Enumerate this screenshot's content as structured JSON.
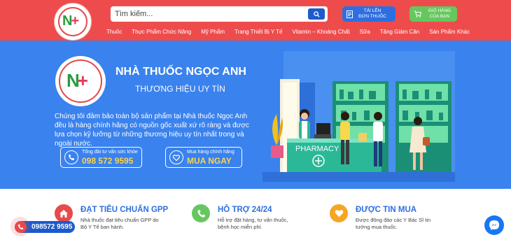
{
  "header": {
    "logo_alt": "Nhà Thuốc Ngọc Anh logo",
    "search": {
      "placeholder": "Tìm kiếm..."
    },
    "upload": {
      "line1": "TẢI LÊN",
      "line2": "ĐƠN THUỐC"
    },
    "cart": {
      "line1": "GIỎ HÀNG",
      "line2": "CỦA BẠN"
    },
    "nav": [
      {
        "label": "Thuốc"
      },
      {
        "label": "Thực Phẩm Chức Năng"
      },
      {
        "label": "Mỹ Phẩm"
      },
      {
        "label": "Trang Thiết Bị Y Tế"
      },
      {
        "label": "Vitamin – Khoáng Chất"
      },
      {
        "label": "Sữa"
      },
      {
        "label": "Tăng Giảm Cân"
      },
      {
        "label": "Sản Phẩm Khác"
      }
    ]
  },
  "hero": {
    "title": "NHÀ THUỐC NGỌC ANH",
    "subtitle": "THƯƠNG HIỆU UY TÍN",
    "description": "Chúng tôi đảm bảo toàn bộ sản phẩm tại Nhà thuốc Ngọc Anh đều là hàng chính hãng có nguồn gốc xuất xứ rõ ràng và được lựa chọn kỹ lưỡng từ những thương hiệu uy tín nhất trong và ngoài nước.",
    "hotline": {
      "label": "Tổng đài tư vấn sức khỏe",
      "value": "098 572 9595"
    },
    "buy": {
      "label": "Mua hàng chính hãng",
      "value": "MUA NGAY"
    },
    "pharmacy_sign": "PHARMACY"
  },
  "features": [
    {
      "title": "ĐẠT TIÊU CHUẨN GPP",
      "line1": "Nhà thuốc đạt tiêu chuẩn GPP do",
      "line2": "Bộ Y Tế ban hành.",
      "icon": "home-icon",
      "color": "#e84a4a"
    },
    {
      "title": "HỖ TRỢ 24/24",
      "line1": "Hỗ trợ đặt hàng, tư vấn thuốc,",
      "line2": "bệnh học miễn phí.",
      "icon": "phone-icon",
      "color": "#66c75e"
    },
    {
      "title": "ĐƯỢC TIN MUA",
      "line1": "Được đông đảo các Y Bác Sĩ tin",
      "line2": "tưởng mua thuốc.",
      "icon": "heart-icon",
      "color": "#f6a623"
    }
  ],
  "floating": {
    "phone": "098572 9595"
  },
  "colors": {
    "header": "#ee4c4c",
    "hero": "#3a82ee",
    "accent_blue": "#2d6fe0",
    "accent_green": "#66c75e",
    "accent_yellow": "#ffd44a"
  }
}
